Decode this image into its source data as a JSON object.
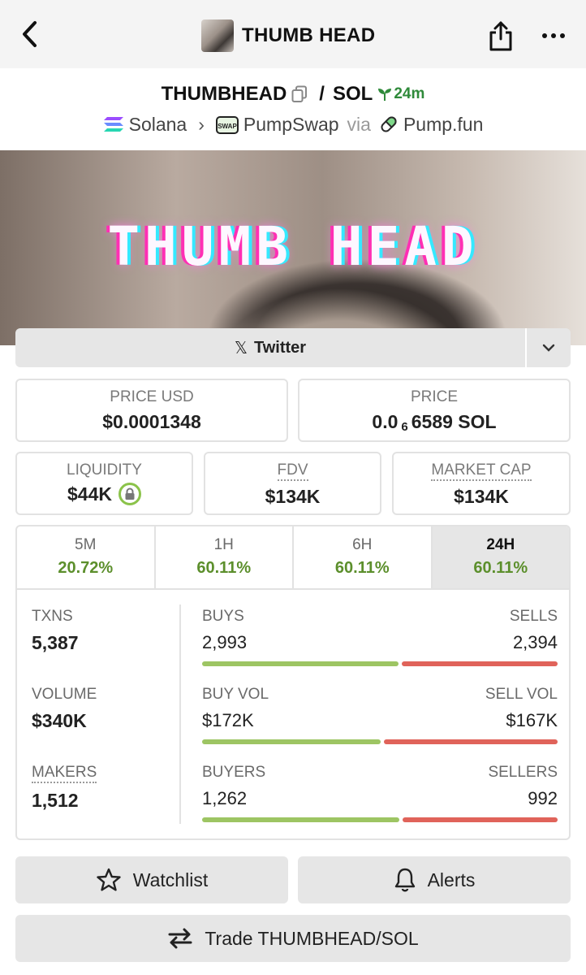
{
  "header": {
    "title": "THUMB HEAD"
  },
  "pair": {
    "base": "THUMBHEAD",
    "separator": "/",
    "quote": "SOL",
    "age": "24m"
  },
  "chain": {
    "network": "Solana",
    "dex": "PumpSwap",
    "via_label": "via",
    "launchpad": "Pump.fun",
    "dex_badge": "SWAP"
  },
  "banner": {
    "text": "THUMB HEAD"
  },
  "twitter": {
    "label": "Twitter",
    "x_glyph": "𝕏"
  },
  "stats": {
    "price_usd": {
      "label": "PRICE USD",
      "value": "$0.0001348"
    },
    "price": {
      "label": "PRICE",
      "prefix": "0.0",
      "zeros": "6",
      "suffix": "6589 SOL"
    },
    "liquidity": {
      "label": "LIQUIDITY",
      "value": "$44K"
    },
    "fdv": {
      "label": "FDV",
      "value": "$134K"
    },
    "market_cap": {
      "label": "MARKET CAP",
      "value": "$134K"
    }
  },
  "timeframes": [
    {
      "label": "5M",
      "change": "20.72%"
    },
    {
      "label": "1H",
      "change": "60.11%"
    },
    {
      "label": "6H",
      "change": "60.11%"
    },
    {
      "label": "24H",
      "change": "60.11%"
    }
  ],
  "selected_timeframe": "24H",
  "metrics": {
    "txns": {
      "label": "TXNS",
      "value": "5,387"
    },
    "volume": {
      "label": "VOLUME",
      "value": "$340K"
    },
    "makers": {
      "label": "MAKERS",
      "value": "1,512"
    }
  },
  "ratios": {
    "txns": {
      "left_label": "BUYS",
      "left_value": "2,993",
      "right_label": "SELLS",
      "right_value": "2,394",
      "buy_fraction": 0.556
    },
    "volume": {
      "left_label": "BUY VOL",
      "left_value": "$172K",
      "right_label": "SELL VOL",
      "right_value": "$167K",
      "buy_fraction": 0.507
    },
    "makers": {
      "left_label": "BUYERS",
      "left_value": "1,262",
      "right_label": "SELLERS",
      "right_value": "992",
      "buy_fraction": 0.56
    }
  },
  "actions": {
    "watchlist": "Watchlist",
    "alerts": "Alerts",
    "trade": "Trade THUMBHEAD/SOL"
  },
  "colors": {
    "positive": "#5c8f2c",
    "buy_bar": "#9dc563",
    "sell_bar": "#e0635a",
    "age": "#2f8a3a"
  }
}
